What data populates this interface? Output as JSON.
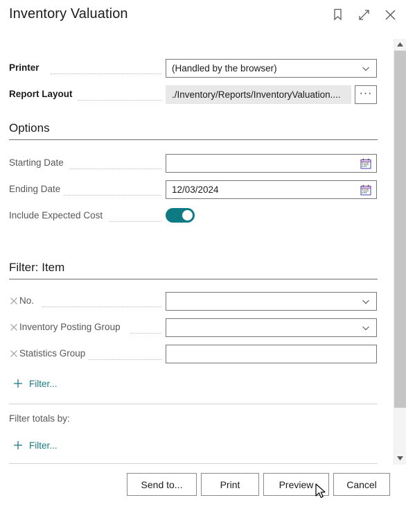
{
  "window": {
    "title": "Inventory Valuation",
    "actions": [
      {
        "name": "bookmark-icon",
        "label": "Bookmark"
      },
      {
        "name": "expand-icon",
        "label": "Expand"
      },
      {
        "name": "close-icon",
        "label": "Close"
      }
    ]
  },
  "general": {
    "printer": {
      "label": "Printer",
      "value": "(Handled by the browser)"
    },
    "report_layout": {
      "label": "Report Layout",
      "value": "./Inventory/Reports/InventoryValuation....",
      "browse_label": "···"
    }
  },
  "options": {
    "heading": "Options",
    "starting_date": {
      "label": "Starting Date",
      "value": ""
    },
    "ending_date": {
      "label": "Ending Date",
      "value": "12/03/2024"
    },
    "include_expected_cost": {
      "label": "Include Expected Cost",
      "state": "on"
    }
  },
  "filter_item": {
    "heading": "Filter: Item",
    "rows": [
      {
        "label": "No.",
        "value": "",
        "has_dropdown": true
      },
      {
        "label": "Inventory Posting Group",
        "value": "",
        "has_dropdown": true
      },
      {
        "label": "Statistics Group",
        "value": "",
        "has_dropdown": false
      }
    ],
    "add_filter_label": "Filter..."
  },
  "filter_totals": {
    "heading": "Filter totals by:",
    "add_filter_label": "Filter..."
  },
  "footer": {
    "buttons": [
      {
        "name": "send-to-button",
        "label": "Send to..."
      },
      {
        "name": "print-button",
        "label": "Print"
      },
      {
        "name": "preview-button",
        "label": "Preview"
      },
      {
        "name": "cancel-button",
        "label": "Cancel"
      }
    ]
  },
  "colors": {
    "accent_teal": "#0e7b84",
    "link_teal": "#1c7b84",
    "text_dark": "#1b1b1b",
    "text_muted": "#575757",
    "field_border": "#767676",
    "readonly_fill": "#e8e8e8"
  }
}
